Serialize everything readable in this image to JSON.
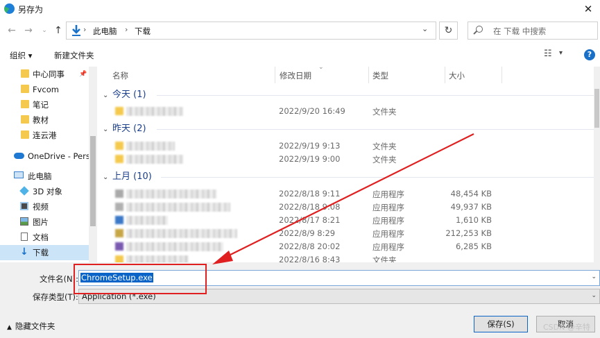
{
  "title": "另存为",
  "address": {
    "crumbs": [
      "此电脑",
      "下载"
    ]
  },
  "search": {
    "placeholder": "在 下载 中搜索"
  },
  "toolbar": {
    "organize": "组织 ▾",
    "new_folder": "新建文件夹"
  },
  "sidebar": {
    "items": [
      {
        "label": "中心同事",
        "icon": "folder-icon",
        "pinned": true
      },
      {
        "label": "Fvcom",
        "icon": "folder-icon"
      },
      {
        "label": "笔记",
        "icon": "folder-icon"
      },
      {
        "label": "教材",
        "icon": "folder-icon"
      },
      {
        "label": "连云港",
        "icon": "folder-icon"
      },
      {
        "label": "OneDrive - Perso",
        "icon": "cloud-icon"
      },
      {
        "label": "此电脑",
        "icon": "computer-icon"
      },
      {
        "label": "3D 对象",
        "icon": "cube-icon"
      },
      {
        "label": "视频",
        "icon": "video-icon"
      },
      {
        "label": "图片",
        "icon": "image-icon"
      },
      {
        "label": "文档",
        "icon": "document-icon"
      },
      {
        "label": "下载",
        "icon": "download-icon",
        "selected": true
      }
    ]
  },
  "columns": {
    "name": "名称",
    "modified": "修改日期",
    "type": "类型",
    "size": "大小"
  },
  "groups": [
    {
      "label": "今天 (1)",
      "rows": [
        {
          "date": "2022/9/20 16:49",
          "type": "文件夹",
          "size": ""
        }
      ]
    },
    {
      "label": "昨天 (2)",
      "rows": [
        {
          "date": "2022/9/19 9:13",
          "type": "文件夹",
          "size": ""
        },
        {
          "date": "2022/9/19 9:00",
          "type": "文件夹",
          "size": ""
        }
      ]
    },
    {
      "label": "上月 (10)",
      "rows": [
        {
          "date": "2022/8/18 9:11",
          "type": "应用程序",
          "size": "48,454 KB"
        },
        {
          "date": "2022/8/18 9:08",
          "type": "应用程序",
          "size": "49,937 KB"
        },
        {
          "date": "2022/8/17 8:21",
          "type": "应用程序",
          "size": "1,610 KB"
        },
        {
          "date": "2022/8/9 8:29",
          "type": "应用程序",
          "size": "212,253 KB"
        },
        {
          "date": "2022/8/8 20:02",
          "type": "应用程序",
          "size": "6,285 KB"
        },
        {
          "date": "2022/8/16 8:43",
          "type": "文件夹",
          "size": ""
        }
      ]
    }
  ],
  "form": {
    "filename_label": "文件名(N):",
    "filename_value": "ChromeSetup.exe",
    "filetype_label": "保存类型(T):",
    "filetype_value": "Application (*.exe)"
  },
  "footer": {
    "hide_folders": "隐藏文件夹",
    "save": "保存(S)",
    "cancel": "取消"
  },
  "watermark": "CSDN @辛特",
  "colors": {
    "accent": "#0a64c8",
    "annotation": "#e02020",
    "folder": "#f4c94d"
  }
}
